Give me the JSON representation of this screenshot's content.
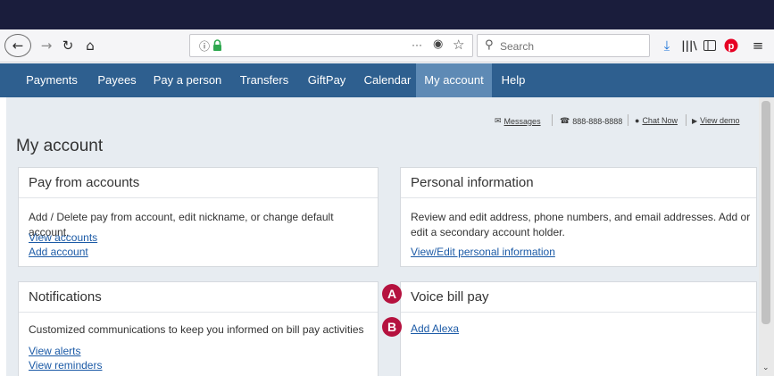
{
  "browser": {
    "back_icon": "arrow-left",
    "forward_icon": "arrow-right",
    "reload_icon": "reload",
    "home_icon": "house",
    "url_info_icon": "circle-info",
    "url_lock_icon": "padlock",
    "url_more": "···",
    "search_placeholder": "Search",
    "accent_colors": {
      "lock": "#2fa84f",
      "download": "#1b73d9",
      "pinterest": "#e60023"
    }
  },
  "nav": {
    "items": [
      {
        "label": "Payments"
      },
      {
        "label": "Payees"
      },
      {
        "label": "Pay a person"
      },
      {
        "label": "Transfers"
      },
      {
        "label": "GiftPay"
      },
      {
        "label": "Calendar"
      },
      {
        "label": "My account",
        "active": true
      },
      {
        "label": "Help"
      }
    ],
    "color": "#2e5f8f",
    "active_color": "#5e8ab5"
  },
  "utility": {
    "messages": "Messages",
    "phone": "888-888-8888",
    "chat": "Chat Now",
    "demo": "View demo"
  },
  "page": {
    "title": "My account"
  },
  "cards": {
    "pay_from": {
      "title": "Pay from accounts",
      "text": "Add / Delete pay from account, edit nickname, or change default account.",
      "links": [
        "View accounts",
        "Add account"
      ]
    },
    "personal": {
      "title": "Personal information",
      "text": "Review and edit address, phone numbers, and email addresses. Add or edit a secondary account holder.",
      "links": [
        "View/Edit personal information"
      ]
    },
    "notifications": {
      "title": "Notifications",
      "text": "Customized communications to keep you informed on bill pay activities",
      "links": [
        "View alerts",
        "View reminders"
      ]
    },
    "voice": {
      "title": "Voice bill pay",
      "links": [
        "Add Alexa"
      ]
    }
  },
  "markers": {
    "a": "A",
    "b": "B",
    "color": "#b5123f"
  }
}
